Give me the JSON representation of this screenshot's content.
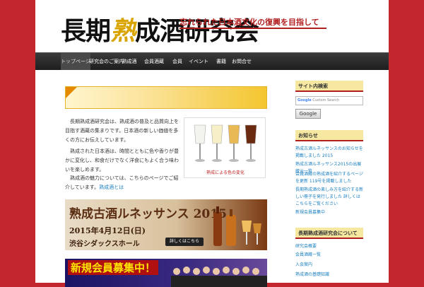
{
  "header": {
    "logo_before": "長期",
    "logo_ku": "熟",
    "logo_after": "成酒研究会",
    "tagline": "忘れられた日本酒文化の復興を目指して"
  },
  "nav": {
    "items": [
      {
        "label": "トップページ"
      },
      {
        "label": "研究会のご案内"
      },
      {
        "label": "熟成酒"
      },
      {
        "label": "会員酒蔵"
      },
      {
        "label": "会員"
      },
      {
        "label": "イベント"
      },
      {
        "label": "書籍"
      },
      {
        "label": "お問合せ"
      }
    ]
  },
  "main": {
    "title": "",
    "paragraphs": [
      "長期熟成酒研究会は、熟成酒の普及と品質向上を目指す酒蔵の集まりです。日本酒の新しい価値を多くの方にお伝えしています。",
      "熟成された日本酒は、時間とともに色や香りが豊かに変化し、和食だけでなく洋食にもよく合う味わいを楽しめます。",
      "熟成酒の魅力については、こちらのページでご紹介しています。"
    ],
    "link_text": "熟成酒とは",
    "figure_caption": "熟成による色の変化",
    "banner1": {
      "title": "熟成古酒ルネッサンス 2015",
      "date": "2015年4月12日(日)",
      "venue": "渋谷シダックスホール",
      "button": "詳しくはこちら"
    },
    "banner2": {
      "title": "新規会員募集中！"
    }
  },
  "sidebar": {
    "search_title": "サイト内検索",
    "search_placeholder": "Custom Search",
    "search_brand": "Google",
    "search_button": "Google",
    "news_title": "お知らせ",
    "news": [
      "熟成古酒ルネッサンスのお知らせを掲載しました 2015",
      "熟成古酒ルネッサンス2015の出展蔵元一覧",
      "会員酒蔵の熟成酒を紹介するページを更新 119号を掲載しました",
      "長期熟成酒の楽しみ方を紹介する新しい冊子を発行しました 詳しくはこちらをご覧ください",
      "新規会員募集中"
    ],
    "links_title": "長期熟成酒研究会について",
    "links": [
      "研究会概要",
      "会員酒蔵一覧",
      "入会案内",
      "熟成酒の基礎知識"
    ]
  },
  "colors": {
    "page_bg": "#c4262e",
    "nav_bg": "#2a2a2a",
    "accent_gold": "#f3c62f",
    "link": "#1a7fc0"
  }
}
